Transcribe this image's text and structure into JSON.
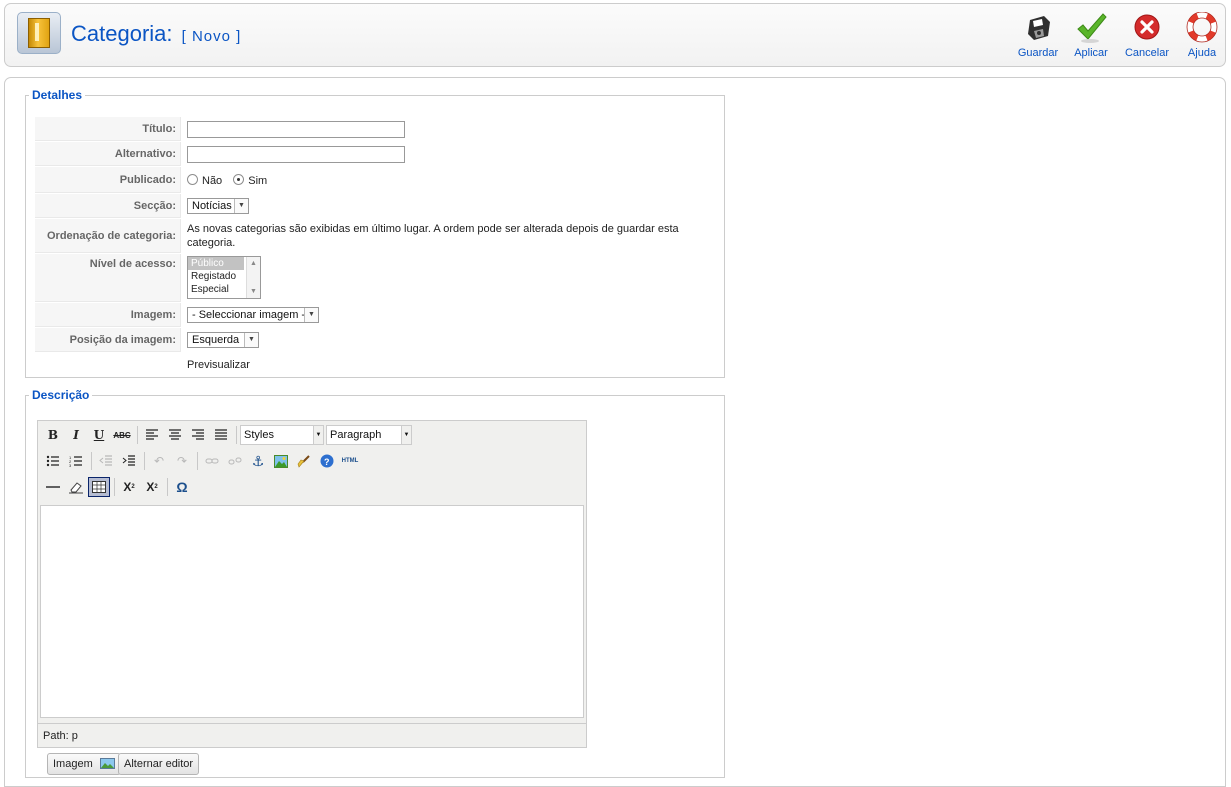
{
  "header": {
    "title": "Categoria:",
    "subtitle": "[ Novo ]",
    "toolbar": {
      "save": "Guardar",
      "apply": "Aplicar",
      "cancel": "Cancelar",
      "help": "Ajuda"
    }
  },
  "details": {
    "legend": "Detalhes",
    "title_label": "Título:",
    "title_value": "",
    "alias_label": "Alternativo:",
    "alias_value": "",
    "published_label": "Publicado:",
    "published_no": "Não",
    "published_yes": "Sim",
    "published_selected": "Sim",
    "section_label": "Secção:",
    "section_value": "Notícias",
    "ordering_label": "Ordenação de categoria:",
    "ordering_text": "As novas categorias são exibidas em último lugar. A ordem pode ser alterada depois de guardar esta categoria.",
    "access_label": "Nível de acesso:",
    "access_options": [
      "Público",
      "Registado",
      "Especial"
    ],
    "access_selected": "Público",
    "image_label": "Imagem:",
    "image_value": "- Seleccionar imagem -",
    "image_position_label": "Posição da imagem:",
    "image_position_value": "Esquerda",
    "preview": "Previsualizar"
  },
  "description": {
    "legend": "Descrição",
    "styles_select": "Styles",
    "format_select": "Paragraph",
    "path": "Path: p",
    "image_button": "Imagem",
    "toggle_editor_button": "Alternar editor"
  },
  "colors": {
    "accent": "#0b55c4",
    "apply_green": "#5ab52a",
    "cancel_red": "#d42b2b"
  }
}
